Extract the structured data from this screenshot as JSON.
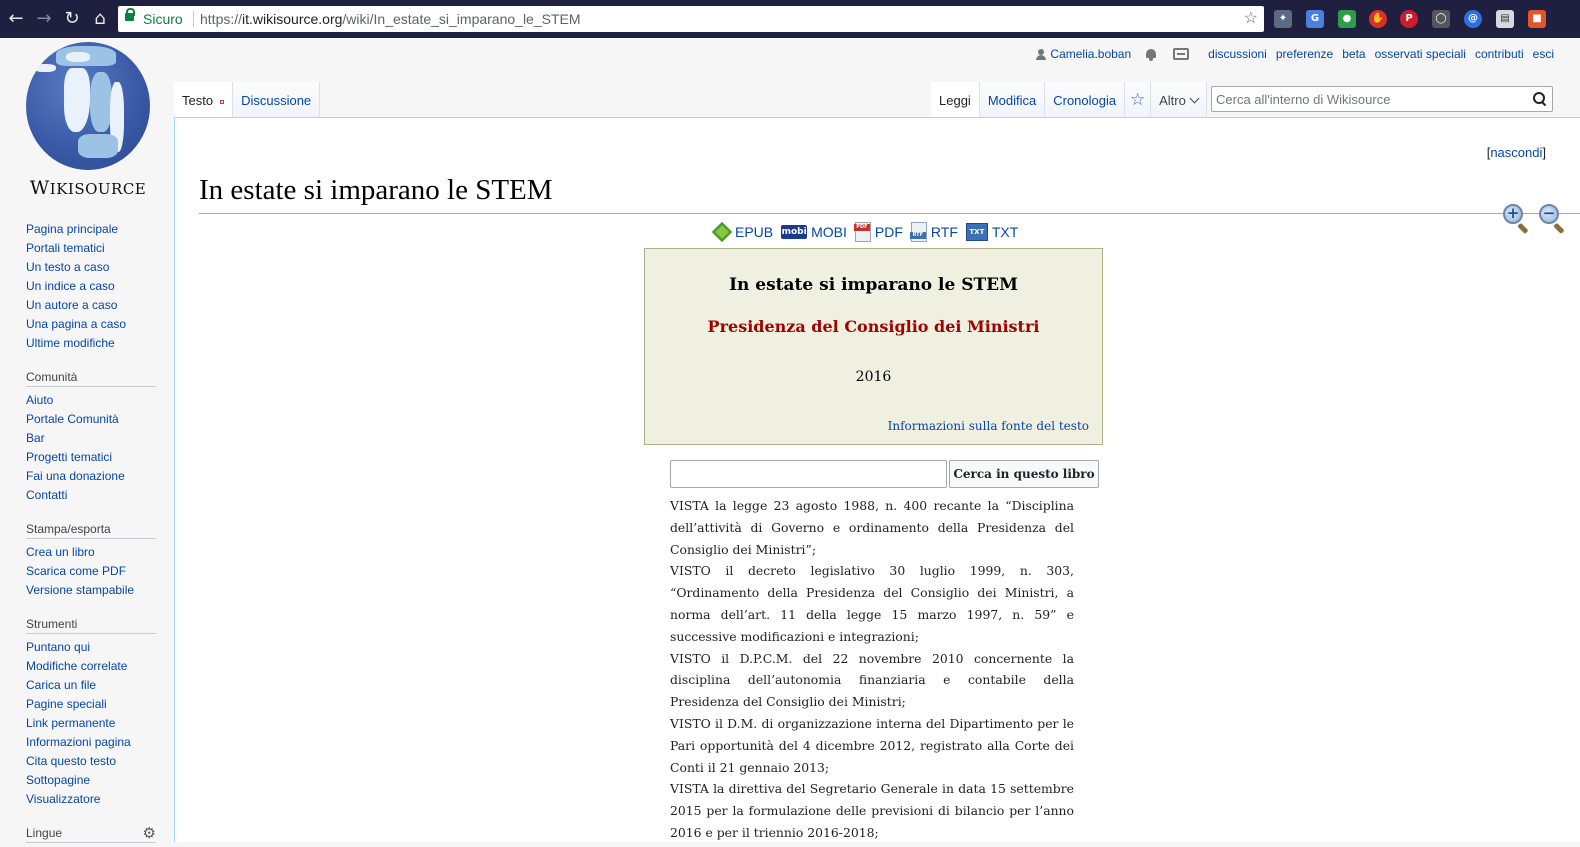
{
  "browser": {
    "secure_label": "Sicuro",
    "url_scheme": "https://",
    "url_host": "it.wikisource.org",
    "url_path": "/wiki/In_estate_si_imparano_le_STEM",
    "extensions": [
      "puzzle-extension",
      "translate-extension",
      "green-extension",
      "shield-extension",
      "pinterest-extension",
      "lightbulb-extension",
      "at-extension",
      "note-extension",
      "office-extension"
    ]
  },
  "logo": {
    "text_big": "W",
    "text_small": "IKISOURCE"
  },
  "sidebar": {
    "nav": [
      "Pagina principale",
      "Portali tematici",
      "Un testo a caso",
      "Un indice a caso",
      "Un autore a caso",
      "Una pagina a caso",
      "Ultime modifiche"
    ],
    "community_heading": "Comunità",
    "community": [
      "Aiuto",
      "Portale Comunità",
      "Bar",
      "Progetti tematici",
      "Fai una donazione",
      "Contatti"
    ],
    "print_heading": "Stampa/esporta",
    "print": [
      "Crea un libro",
      "Scarica come PDF",
      "Versione stampabile"
    ],
    "tools_heading": "Strumenti",
    "tools": [
      "Puntano qui",
      "Modifiche correlate",
      "Carica un file",
      "Pagine speciali",
      "Link permanente",
      "Informazioni pagina",
      "Cita questo testo",
      "Sottopagine",
      "Visualizzatore"
    ],
    "languages_heading": "Lingue"
  },
  "personal": {
    "username": "Camelia.boban",
    "links": [
      "discussioni",
      "preferenze",
      "beta",
      "osservati speciali",
      "contributi",
      "esci"
    ]
  },
  "tabs": {
    "left": [
      "Testo",
      "Discussione"
    ],
    "right": [
      "Leggi",
      "Modifica",
      "Cronologia"
    ],
    "more": "Altro"
  },
  "search": {
    "placeholder": "Cerca all'interno di Wikisource"
  },
  "content": {
    "hide_open": "[",
    "hide_label": "nascondi",
    "hide_close": "]",
    "title": "In estate si imparano le STEM",
    "exports": [
      "EPUB",
      "MOBI",
      "PDF",
      "RTF",
      "TXT"
    ],
    "mobi_icon_text": "mobi",
    "pdf_icon_text": "PDF",
    "rtf_icon_text": "RTF",
    "txt_icon_text": "TXT",
    "header": {
      "title": "In estate si imparano le STEM",
      "author": "Presidenza del Consiglio dei Ministri",
      "year": "2016",
      "source_link": "Informazioni sulla fonte del testo"
    },
    "book_search_button": "Cerca in questo libro",
    "paragraphs": [
      "VISTA la legge 23 agosto 1988, n. 400 recante la “Disciplina dell’attività di Governo e ordinamento della Presidenza del Consiglio dei Ministri”;",
      "VISTO il decreto legislativo 30 luglio 1999, n. 303, “Ordinamento della Presidenza del Consiglio dei Ministri, a norma dell’art. 11 della legge 15 marzo 1997, n. 59” e successive modificazioni e integrazioni;",
      "VISTO il D.P.C.M. del 22 novembre 2010 concernente la disciplina dell’autonomia finanziaria e contabile della Presidenza del Consiglio dei Ministri;",
      "VISTO il D.M. di organizzazione interna del Dipartimento per le Pari opportunità del 4 dicembre 2012, registrato alla Corte dei Conti il 21 gennaio 2013;",
      "VISTA la direttiva del Segretario Generale in data 15 settembre 2015 per la formulazione delle previsioni di bilancio per l’anno 2016 e per il triennio 2016-2018;"
    ]
  }
}
